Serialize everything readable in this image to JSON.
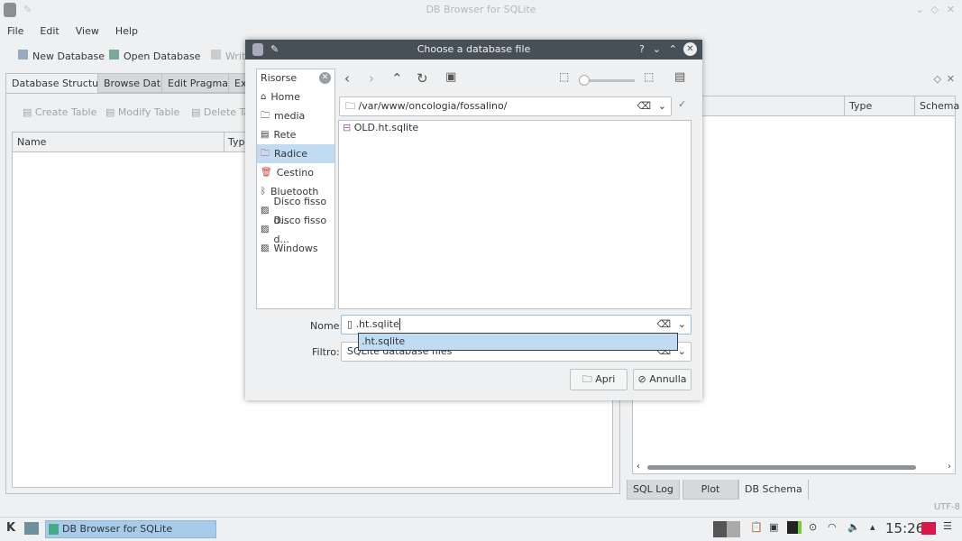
{
  "window": {
    "title": "DB Browser for SQLite"
  },
  "menu": [
    "File",
    "Edit",
    "View",
    "Help"
  ],
  "toolbar": {
    "new_db": "New Database",
    "open_db": "Open Database",
    "write": "Write"
  },
  "main_tabs": [
    "Database Structure",
    "Browse Data",
    "Edit Pragmas",
    "Exe"
  ],
  "structure_toolbar": {
    "create": "Create Table",
    "modify": "Modify Table",
    "delete": "Delete Table"
  },
  "structure_columns": [
    "Name",
    "Type"
  ],
  "schema_panel": {
    "columns": [
      "Type",
      "Schema"
    ],
    "bottom_tabs": [
      "SQL Log",
      "Plot",
      "DB Schema"
    ]
  },
  "status": {
    "encoding": "UTF-8"
  },
  "dialog": {
    "title": "Choose a database file",
    "places_header": "Risorse",
    "places": [
      {
        "label": "Home",
        "icon": "home-icon"
      },
      {
        "label": "media",
        "icon": "folder-icon"
      },
      {
        "label": "Rete",
        "icon": "network-icon"
      },
      {
        "label": "Radice",
        "icon": "root-folder-icon",
        "selected": true
      },
      {
        "label": "Cestino",
        "icon": "trash-icon"
      },
      {
        "label": "Bluetooth",
        "icon": "bluetooth-icon"
      },
      {
        "label": "Disco fisso d...",
        "icon": "drive-icon"
      },
      {
        "label": "Disco fisso d...",
        "icon": "drive-icon"
      },
      {
        "label": "Windows",
        "icon": "drive-icon"
      }
    ],
    "path": "/var/www/oncologia/fossalino/",
    "files": [
      "OLD.ht.sqlite"
    ],
    "name_label": "Nome:",
    "name_value": ".ht.sqlite",
    "completion": ".ht.sqlite",
    "filter_label": "Filtro:",
    "filter_value": "SQLite database files",
    "open_button": "Apri",
    "cancel_button": "Annulla"
  },
  "taskbar": {
    "task": "DB Browser for SQLite",
    "clock": "15:26"
  }
}
